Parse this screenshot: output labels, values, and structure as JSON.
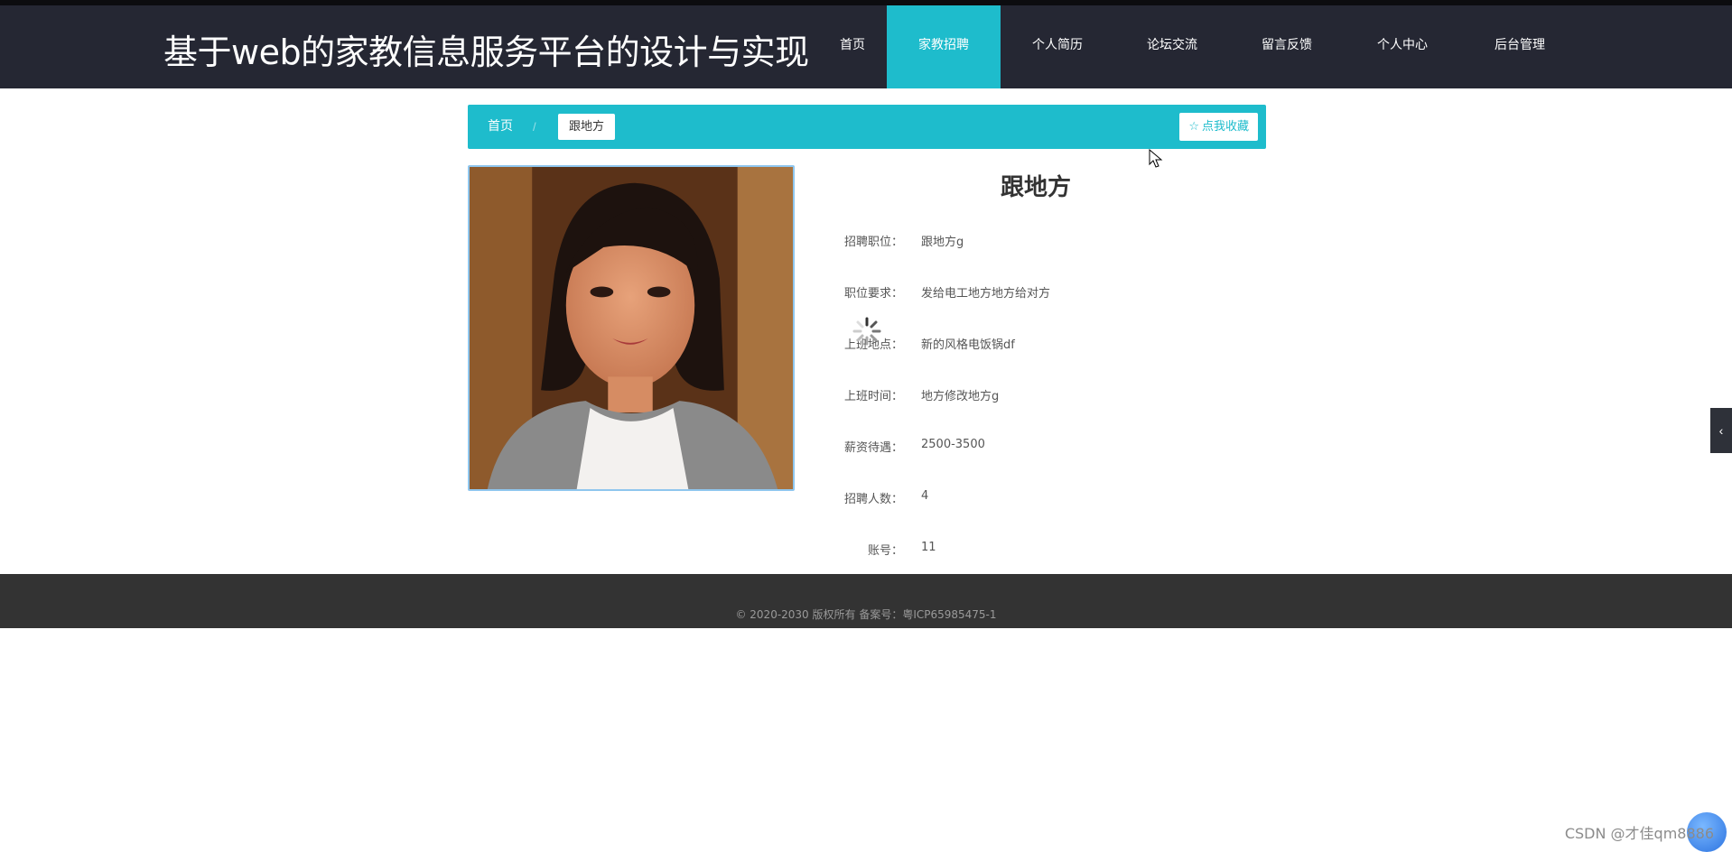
{
  "header": {
    "site_title": "基于web的家教信息服务平台的设计与实现",
    "nav": [
      {
        "label": "首页"
      },
      {
        "label": "家教招聘",
        "active": true
      },
      {
        "label": "个人简历"
      },
      {
        "label": "论坛交流"
      },
      {
        "label": "留言反馈"
      },
      {
        "label": "个人中心"
      },
      {
        "label": "后台管理"
      }
    ]
  },
  "breadcrumb": {
    "home": "首页",
    "separator": "/",
    "current": "跟地方",
    "favorite_label": "点我收藏",
    "favorite_icon": "star-outline-icon"
  },
  "detail": {
    "title": "跟地方",
    "fields": [
      {
        "label": "招聘职位：",
        "value": "跟地方g"
      },
      {
        "label": "职位要求：",
        "value": "发给电工地方地方给对方"
      },
      {
        "label": "上班地点：",
        "value": "新的风格电饭锅df"
      },
      {
        "label": "上班时间：",
        "value": "地方修改地方g"
      },
      {
        "label": "薪资待遇：",
        "value": "2500-3500"
      },
      {
        "label": "招聘人数：",
        "value": "4"
      },
      {
        "label": "账号：",
        "value": "11"
      }
    ]
  },
  "footer": {
    "copyright": "© 2020-2030 版权所有 备案号：粤ICP65985475-1"
  },
  "watermark": "CSDN @才佳qm8886",
  "colors": {
    "header_bg": "#252733",
    "accent": "#1ebccc",
    "footer_bg": "#333333"
  }
}
